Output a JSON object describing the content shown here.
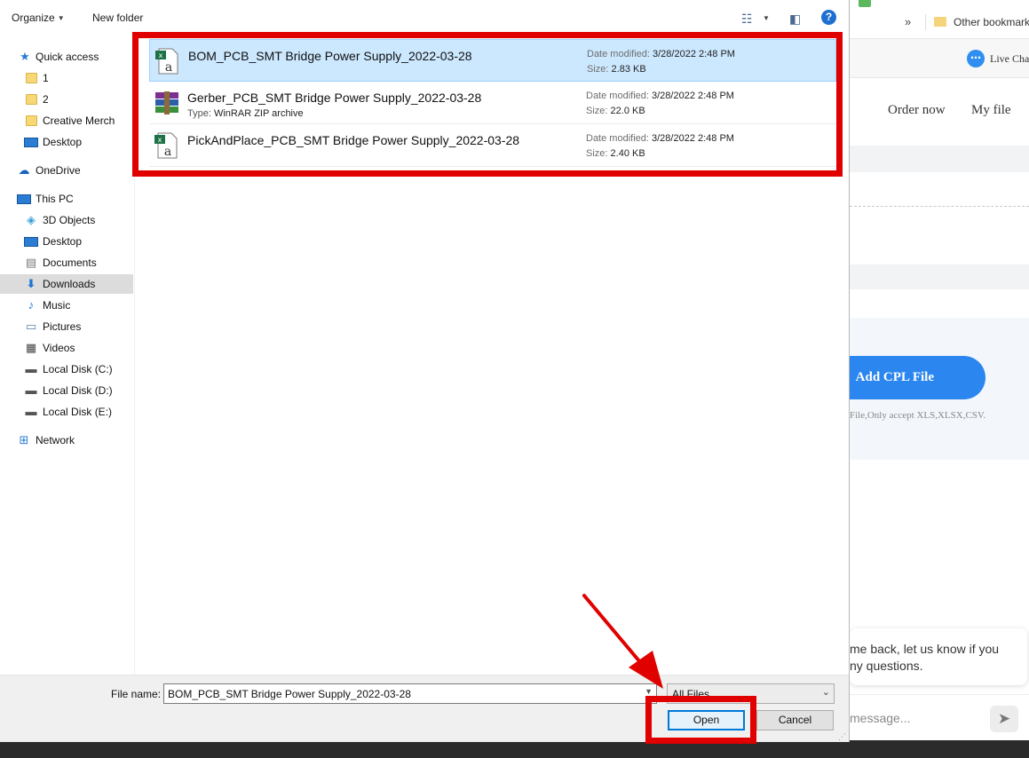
{
  "background_page": {
    "bookmarks_overflow": "»",
    "bookmark_folder_label": "Other bookmark",
    "live_chat_label": "Live Cha",
    "nav_links": [
      "Order now",
      "My file"
    ],
    "add_cpl_button": "Add CPL File",
    "cpl_note": "File,Only accept XLS,XLSX,CSV.",
    "chat_bubble_text": "me back, let us know if you\nny questions.",
    "chat_input_placeholder": "message..."
  },
  "toolbar": {
    "organize_label": "Organize",
    "new_folder_label": "New folder",
    "help_label": "?"
  },
  "nav_pane": {
    "items": [
      {
        "label": "Quick access",
        "icon": "star-icon"
      },
      {
        "label": "1",
        "icon": "folder-icon"
      },
      {
        "label": "2",
        "icon": "folder-icon"
      },
      {
        "label": "Creative Merch",
        "icon": "folder-icon"
      },
      {
        "label": "Desktop",
        "icon": "desktop-icon"
      },
      {
        "label": "OneDrive",
        "icon": "cloud-icon"
      },
      {
        "label": "This PC",
        "icon": "computer-icon"
      },
      {
        "label": "3D Objects",
        "icon": "cube-icon"
      },
      {
        "label": "Desktop",
        "icon": "desktop-icon"
      },
      {
        "label": "Documents",
        "icon": "document-icon"
      },
      {
        "label": "Downloads",
        "icon": "download-icon",
        "selected": true
      },
      {
        "label": "Music",
        "icon": "music-icon"
      },
      {
        "label": "Pictures",
        "icon": "pictures-icon"
      },
      {
        "label": "Videos",
        "icon": "video-icon"
      },
      {
        "label": "Local Disk (C:)",
        "icon": "disk-icon"
      },
      {
        "label": "Local Disk (D:)",
        "icon": "disk-icon"
      },
      {
        "label": "Local Disk (E:)",
        "icon": "disk-icon"
      },
      {
        "label": "Network",
        "icon": "network-icon"
      }
    ]
  },
  "files": [
    {
      "name": "BOM_PCB_SMT Bridge Power Supply_2022-03-28",
      "icon": "excel-csv-icon",
      "date_label": "Date modified:",
      "date": "3/28/2022 2:48 PM",
      "size_label": "Size:",
      "size": "2.83 KB",
      "type_label": "",
      "type": "",
      "selected": true
    },
    {
      "name": "Gerber_PCB_SMT Bridge Power Supply_2022-03-28",
      "icon": "winrar-icon",
      "date_label": "Date modified:",
      "date": "3/28/2022 2:48 PM",
      "size_label": "Size:",
      "size": "22.0 KB",
      "type_label": "Type:",
      "type": "WinRAR ZIP archive",
      "selected": false
    },
    {
      "name": "PickAndPlace_PCB_SMT Bridge Power Supply_2022-03-28",
      "icon": "excel-csv-icon",
      "date_label": "Date modified:",
      "date": "3/28/2022 2:48 PM",
      "size_label": "Size:",
      "size": "2.40 KB",
      "type_label": "",
      "type": "",
      "selected": false
    }
  ],
  "bottom": {
    "file_name_label": "File name:",
    "file_name_value": "BOM_PCB_SMT Bridge Power Supply_2022-03-28",
    "filter_value": "All Files",
    "open_label": "Open",
    "cancel_label": "Cancel"
  },
  "annotation_color": "#e00000"
}
